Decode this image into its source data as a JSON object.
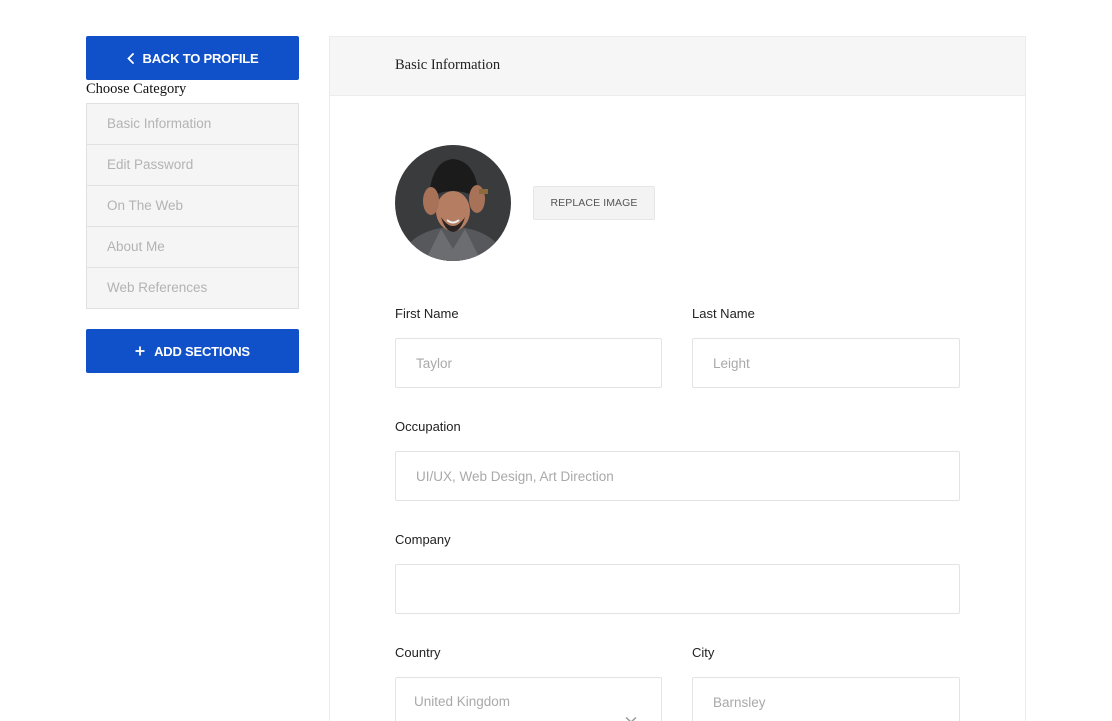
{
  "sidebar": {
    "back_label": "BACK TO PROFILE",
    "choose_category": "Choose Category",
    "items": [
      {
        "label": "Basic Information"
      },
      {
        "label": "Edit Password"
      },
      {
        "label": "On The Web"
      },
      {
        "label": "About Me"
      },
      {
        "label": "Web References"
      }
    ],
    "add_label": "ADD SECTIONS"
  },
  "panel": {
    "title": "Basic Information",
    "replace_image_label": "REPLACE IMAGE"
  },
  "form": {
    "first_name": {
      "label": "First Name",
      "placeholder": "Taylor"
    },
    "last_name": {
      "label": "Last Name",
      "placeholder": "Leight"
    },
    "occupation": {
      "label": "Occupation",
      "placeholder": "UI/UX, Web Design, Art Direction"
    },
    "company": {
      "label": "Company",
      "placeholder": ""
    },
    "country": {
      "label": "Country",
      "value": "United Kingdom"
    },
    "city": {
      "label": "City",
      "placeholder": "Barnsley"
    }
  },
  "colors": {
    "primary": "#1050c8",
    "muted_text": "#b3b3b3",
    "panel_header_bg": "#f6f6f6"
  }
}
